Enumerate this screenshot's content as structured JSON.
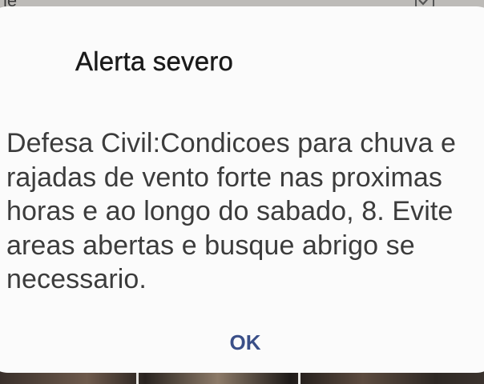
{
  "background": {
    "top_text_fragment": "le"
  },
  "dialog": {
    "title": "Alerta severo",
    "message": "Defesa Civil:Condicoes para chuva e rajadas de vento forte nas proximas horas e ao longo do sabado, 8. Evite areas abertas e busque abrigo se necessario.",
    "ok_label": "OK"
  },
  "colors": {
    "dialog_background": "#fbfbfb",
    "title_text": "#1a1a1a",
    "message_text": "#3c3c3c",
    "button_text": "#3a4f88"
  },
  "icons": {
    "background_checkbox": "checkbox-checked-icon"
  }
}
